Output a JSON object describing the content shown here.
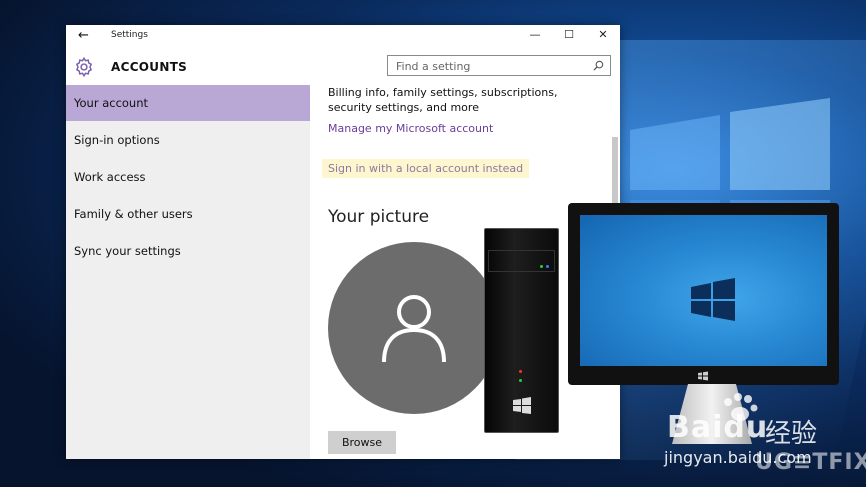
{
  "window": {
    "title": "Settings",
    "controls": {
      "minimize": "—",
      "maximize": "☐",
      "close": "✕"
    },
    "back": "←"
  },
  "header": {
    "section_title": "ACCOUNTS",
    "search_placeholder": "Find a setting"
  },
  "sidebar": {
    "items": [
      {
        "label": "Your account",
        "active": true
      },
      {
        "label": "Sign-in options",
        "active": false
      },
      {
        "label": "Work access",
        "active": false
      },
      {
        "label": "Family & other users",
        "active": false
      },
      {
        "label": "Sync your settings",
        "active": false
      }
    ]
  },
  "content": {
    "billing_text": "Billing info, family settings, subscriptions, security settings, and more",
    "manage_link": "Manage my Microsoft account",
    "local_account_link": "Sign in with a local account instead",
    "picture_heading": "Your picture",
    "browse_label": "Browse"
  },
  "watermark": {
    "baidu_logo": "Baidu",
    "baidu_cn": "经验",
    "baidu_url": "jingyan.baidu.com",
    "ugetfix": "UG≡TFIX"
  },
  "colors": {
    "accent": "#b9a8d6",
    "link": "#6a3d9a",
    "highlight": "#fdf6cf",
    "avatar": "#6c6c6c"
  }
}
